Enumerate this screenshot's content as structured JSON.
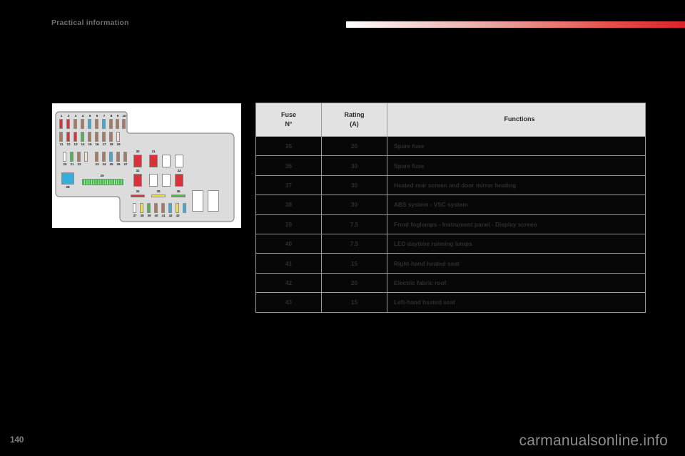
{
  "page": {
    "section_title": "Practical information",
    "page_number": "140",
    "watermark": "carmanualsonline.info",
    "accent_color": "#d8232a"
  },
  "table": {
    "headers": {
      "fuse_line1": "Fuse",
      "fuse_line2": "N°",
      "rating_line1": "Rating",
      "rating_line2": "(A)",
      "functions": "Functions"
    },
    "rows": [
      {
        "fuse": "35",
        "rating": "20",
        "function": "Spare fuse"
      },
      {
        "fuse": "36",
        "rating": "30",
        "function": "Spare fuse"
      },
      {
        "fuse": "37",
        "rating": "30",
        "function": "Heated rear screen and door mirror heating"
      },
      {
        "fuse": "38",
        "rating": "30",
        "function": "ABS system - VSC system"
      },
      {
        "fuse": "39",
        "rating": "7.5",
        "function": "Front foglamps - Instrument panel - Display screen"
      },
      {
        "fuse": "40",
        "rating": "7.5",
        "function": "LED daytime running lamps"
      },
      {
        "fuse": "41",
        "rating": "15",
        "function": "Right-hand heated seat"
      },
      {
        "fuse": "42",
        "rating": "20",
        "function": "Electric fabric roof"
      },
      {
        "fuse": "43",
        "rating": "15",
        "function": "Left-hand heated seat"
      }
    ]
  },
  "fusebox": {
    "title": "fuse-box-diagram",
    "colors": {
      "red": "#d8333a",
      "brown": "#a8785f",
      "blue": "#3ea8d8",
      "green": "#49b74e",
      "peach": "#f5ded2",
      "white": "#ffffff",
      "yellow": "#f2df4e",
      "relay_blue": "#34aede",
      "body": "#dcdcdc",
      "outline": "#9a9a9a"
    },
    "row1": {
      "labels": [
        "1",
        "2",
        "3",
        "4",
        "5",
        "6",
        "7",
        "8",
        "9",
        "10"
      ],
      "fuse_colors": [
        "red",
        "red",
        "brown",
        "brown",
        "blue",
        "brown",
        "blue",
        "brown",
        "brown",
        "brown"
      ]
    },
    "row2": {
      "labels": [
        "11",
        "12",
        "13",
        "14",
        "15",
        "16",
        "17",
        "18",
        "19"
      ],
      "fuse_colors": [
        "brown",
        "red",
        "red",
        "green",
        "brown",
        "brown",
        "brown",
        "brown",
        "peach"
      ]
    },
    "row3a": {
      "labels": [
        "20",
        "21",
        "22"
      ],
      "fuse_colors": [
        "white",
        "green",
        "brown"
      ]
    },
    "row3a_extra": {
      "labels": [
        "22"
      ],
      "fuse_colors": [
        "peach"
      ]
    },
    "row3b": {
      "labels": [
        "23",
        "24",
        "25",
        "26",
        "27"
      ],
      "fuse_colors": [
        "brown",
        "brown",
        "blue",
        "brown",
        "brown"
      ]
    },
    "relay28": {
      "label": "28",
      "color": "relay_blue"
    },
    "strip29": {
      "label": "29",
      "color": "green"
    },
    "maxi_fuses": [
      {
        "label": "30",
        "color": "red"
      },
      {
        "label": "31",
        "color": "red"
      },
      {
        "label": "32",
        "color": "red"
      },
      {
        "label": "33",
        "color": "red"
      }
    ],
    "strips": [
      {
        "label": "34",
        "color": "red"
      },
      {
        "label": "35",
        "color": "yellow"
      },
      {
        "label": "36",
        "color": "green"
      }
    ],
    "row4": {
      "labels": [
        "37",
        "38",
        "39",
        "40",
        "41",
        "42",
        "43"
      ],
      "fuse_colors": [
        "white",
        "yellow",
        "green",
        "brown",
        "brown",
        "blue",
        "yellow",
        "blue"
      ]
    }
  }
}
